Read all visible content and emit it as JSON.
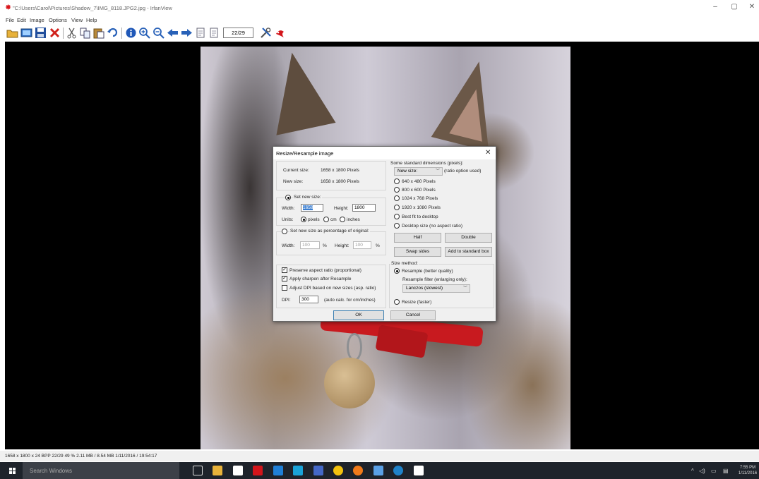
{
  "window": {
    "title": "\"C:\\Users\\Carol\\Pictures\\Shadow_7\\IMG_8118.JPG2.jpg - IrfanView",
    "minimize": "–",
    "maximize": "▢",
    "close": "✕"
  },
  "menu": [
    "File",
    "Edit",
    "Image",
    "Options",
    "View",
    "Help"
  ],
  "toolbar": {
    "page_counter": "22/29",
    "icons": [
      "open-folder-icon",
      "slideshow-icon",
      "save-icon",
      "delete-icon",
      "cut-icon",
      "copy-icon",
      "paste-icon",
      "undo-icon",
      "info-icon",
      "zoom-in-icon",
      "zoom-out-icon",
      "previous-arrow-icon",
      "next-arrow-icon",
      "first-page-icon",
      "last-page-icon",
      "settings-tools-icon",
      "irfanview-logo-icon"
    ]
  },
  "dialog": {
    "title": "Resize/Resample image",
    "close": "✕",
    "current_size_label": "Current size:",
    "current_size_value": "1658  x  1800  Pixels",
    "new_size_label": "New size:",
    "new_size_value": "1658  x  1800  Pixels",
    "set_new_size": "Set new size:",
    "width_label": "Width:",
    "width_value": "1658",
    "height_label": "Height:",
    "height_value": "1800",
    "units_label": "Units:",
    "unit_pixels": "pixels",
    "unit_cm": "cm",
    "unit_inches": "inches",
    "set_percentage": "Set new size as percentage of original:",
    "pct_width_label": "Width:",
    "pct_width_value": "100",
    "pct_width_unit": "%",
    "pct_height_label": "Height:",
    "pct_height_value": "100",
    "pct_height_unit": "%",
    "preserve_aspect": "Preserve aspect ratio (proportional)",
    "apply_sharpen": "Apply sharpen after Resample",
    "adjust_dpi": "Adjust DPI based on new sizes (asp. ratio)",
    "dpi_label": "DPI:",
    "dpi_value": "300",
    "dpi_hint": "(auto calc. for cm/inches)",
    "std_dims_label": "Some standard dimensions (pixels):",
    "std_select": "New size:",
    "std_ratio_hint": "(ratio option used)",
    "std_options": [
      "640 x 480 Pixels",
      "800 x 600 Pixels",
      "1024 x 768 Pixels",
      "1920 x 1080 Pixels",
      "Best fit to desktop",
      "Desktop size (no aspect ratio)"
    ],
    "half_button": "Half",
    "double_button": "Double",
    "swap_button": "Swap sides",
    "add_std_button": "Add to standard box",
    "size_method_label": "Size method:",
    "resample": "Resample (better quality)",
    "resample_filter_label": "Resample filter (enlarging only):",
    "resample_filter_value": "Lanczos (slowest)",
    "resize_faster": "Resize (faster)",
    "ok_button": "OK",
    "cancel_button": "Cancel"
  },
  "status": "1658 x 1800 x 24 BPP    22/29    49 %    2.11 MB / 8.54 MB    1/11/2016 / 19:54:17",
  "taskbar": {
    "search_placeholder": "Search Windows",
    "clock_time": "7:55 PM",
    "clock_date": "1/11/2016"
  }
}
